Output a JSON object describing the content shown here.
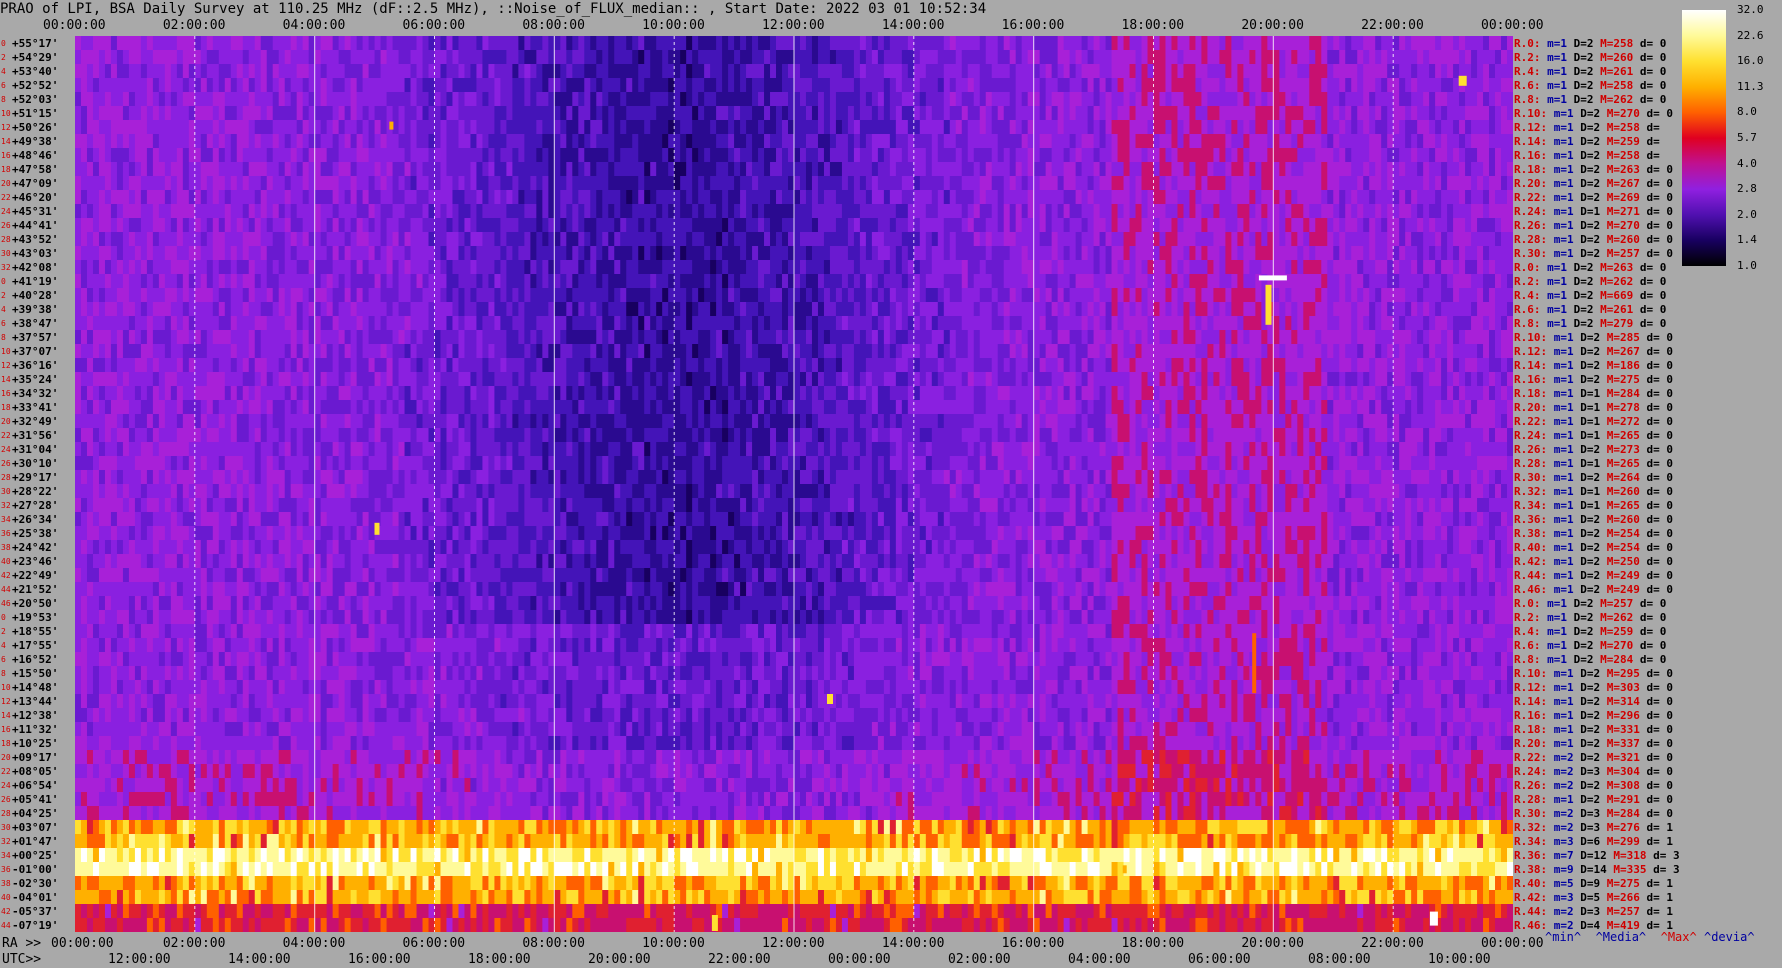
{
  "title": "PRAO of LPI, BSA Daily Survey at 110.25 MHz (dF::2.5 MHz), ::Noise_of_FLUX_median:: , Start Date: 2022 03 01 10:52:34",
  "chart_data": {
    "type": "heatmap",
    "top_axis_ticks": [
      "00:00:00",
      "02:00:00",
      "04:00:00",
      "06:00:00",
      "08:00:00",
      "10:00:00",
      "12:00:00",
      "14:00:00",
      "16:00:00",
      "18:00:00",
      "20:00:00",
      "22:00:00",
      "00:00:00"
    ],
    "ra_axis_prefix": "RA >>",
    "ra_axis_ticks": [
      "00:00:00",
      "02:00:00",
      "04:00:00",
      "06:00:00",
      "08:00:00",
      "10:00:00",
      "12:00:00",
      "14:00:00",
      "16:00:00",
      "18:00:00",
      "20:00:00",
      "22:00:00",
      "00:00:00"
    ],
    "utc_axis_prefix": "UTC>>",
    "utc_axis_ticks": [
      "12:00:00",
      "14:00:00",
      "16:00:00",
      "18:00:00",
      "20:00:00",
      "22:00:00",
      "00:00:00",
      "02:00:00",
      "04:00:00",
      "06:00:00",
      "08:00:00",
      "10:00:00"
    ],
    "colorbar_ticks": [
      "32.0",
      "22.6",
      "16.0",
      "11.3",
      "8.0",
      "5.7",
      "4.0",
      "2.8",
      "2.0",
      "1.4",
      "1.0"
    ],
    "colorbar_colors": [
      "#ffffff",
      "#fffa9a",
      "#ffe030",
      "#ffb000",
      "#ff6000",
      "#e00020",
      "#c01090",
      "#9020e0",
      "#5010b0",
      "#180060",
      "#000000"
    ],
    "y_labels": [
      "+55°17'",
      "+54°29'",
      "+53°40'",
      "+52°52'",
      "+52°03'",
      "+51°15'",
      "+50°26'",
      "+49°38'",
      "+48°46'",
      "+47°58'",
      "+47°09'",
      "+46°20'",
      "+45°31'",
      "+44°41'",
      "+43°52'",
      "+43°03'",
      "+42°08'",
      "+41°19'",
      "+40°28'",
      "+39°38'",
      "+38°47'",
      "+37°57'",
      "+37°07'",
      "+36°16'",
      "+35°24'",
      "+34°32'",
      "+33°41'",
      "+32°49'",
      "+31°56'",
      "+31°04'",
      "+30°10'",
      "+29°17'",
      "+28°22'",
      "+27°28'",
      "+26°34'",
      "+25°38'",
      "+24°42'",
      "+23°46'",
      "+22°49'",
      "+21°52'",
      "+20°50'",
      "+19°53'",
      "+18°55'",
      "+17°55'",
      "+16°52'",
      "+15°50'",
      "+14°48'",
      "+13°44'",
      "+12°38'",
      "+11°32'",
      "+10°25'",
      "+09°17'",
      "+08°05'",
      "+06°54'",
      "+05°41'",
      "+04°25'",
      "+03°07'",
      "+01°47'",
      "+00°25'",
      "-01°00'",
      "-02°30'",
      "-04°01'",
      "-05°37'",
      "-07°19'"
    ],
    "y_indices": [
      "0",
      "2",
      "4",
      "6",
      "8",
      "10",
      "12",
      "14",
      "16",
      "18",
      "20",
      "22",
      "24",
      "26",
      "28",
      "30",
      "32",
      "0",
      "2",
      "4",
      "6",
      "8",
      "10",
      "12",
      "14",
      "16",
      "18",
      "20",
      "22",
      "24",
      "26",
      "28",
      "30",
      "32",
      "34",
      "36",
      "38",
      "40",
      "42",
      "44",
      "46",
      "0",
      "2",
      "4",
      "6",
      "8",
      "10",
      "12",
      "14",
      "16",
      "18",
      "20",
      "22",
      "24",
      "26",
      "28",
      "30",
      "32",
      "34",
      "36",
      "38",
      "40",
      "42",
      "44"
    ],
    "stats_rows": [
      {
        "r": "R.0:",
        "m": "m=1",
        "d": "D=2",
        "M": "M=258",
        "dv": "d= 0"
      },
      {
        "r": "R.2:",
        "m": "m=1",
        "d": "D=2",
        "M": "M=260",
        "dv": "d= 0"
      },
      {
        "r": "R.4:",
        "m": "m=1",
        "d": "D=2",
        "M": "M=261",
        "dv": "d= 0"
      },
      {
        "r": "R.6:",
        "m": "m=1",
        "d": "D=2",
        "M": "M=258",
        "dv": "d= 0"
      },
      {
        "r": "R.8:",
        "m": "m=1",
        "d": "D=2",
        "M": "M=262",
        "dv": "d= 0"
      },
      {
        "r": "R.10:",
        "m": "m=1",
        "d": "D=2",
        "M": "M=270",
        "dv": "d= 0"
      },
      {
        "r": "R.12:",
        "m": "m=1",
        "d": "D=2",
        "M": "M=258",
        "dv": "d="
      },
      {
        "r": "R.14:",
        "m": "m=1",
        "d": "D=2",
        "M": "M=259",
        "dv": "d="
      },
      {
        "r": "R.16:",
        "m": "m=1",
        "d": "D=2",
        "M": "M=258",
        "dv": "d="
      },
      {
        "r": "R.18:",
        "m": "m=1",
        "d": "D=2",
        "M": "M=263",
        "dv": "d= 0"
      },
      {
        "r": "R.20:",
        "m": "m=1",
        "d": "D=2",
        "M": "M=267",
        "dv": "d= 0"
      },
      {
        "r": "R.22:",
        "m": "m=1",
        "d": "D=2",
        "M": "M=269",
        "dv": "d= 0"
      },
      {
        "r": "R.24:",
        "m": "m=1",
        "d": "D=1",
        "M": "M=271",
        "dv": "d= 0"
      },
      {
        "r": "R.26:",
        "m": "m=1",
        "d": "D=2",
        "M": "M=270",
        "dv": "d= 0"
      },
      {
        "r": "R.28:",
        "m": "m=1",
        "d": "D=2",
        "M": "M=260",
        "dv": "d= 0"
      },
      {
        "r": "R.30:",
        "m": "m=1",
        "d": "D=2",
        "M": "M=257",
        "dv": "d= 0"
      },
      {
        "r": "R.0:",
        "m": "m=1",
        "d": "D=2",
        "M": "M=263",
        "dv": "d= 0"
      },
      {
        "r": "R.2:",
        "m": "m=1",
        "d": "D=2",
        "M": "M=262",
        "dv": "d= 0"
      },
      {
        "r": "R.4:",
        "m": "m=1",
        "d": "D=2",
        "M": "M=669",
        "dv": "d= 0"
      },
      {
        "r": "R.6:",
        "m": "m=1",
        "d": "D=2",
        "M": "M=261",
        "dv": "d= 0"
      },
      {
        "r": "R.8:",
        "m": "m=1",
        "d": "D=2",
        "M": "M=279",
        "dv": "d= 0"
      },
      {
        "r": "R.10:",
        "m": "m=1",
        "d": "D=2",
        "M": "M=285",
        "dv": "d= 0"
      },
      {
        "r": "R.12:",
        "m": "m=1",
        "d": "D=2",
        "M": "M=267",
        "dv": "d= 0"
      },
      {
        "r": "R.14:",
        "m": "m=1",
        "d": "D=2",
        "M": "M=186",
        "dv": "d= 0"
      },
      {
        "r": "R.16:",
        "m": "m=1",
        "d": "D=2",
        "M": "M=275",
        "dv": "d= 0"
      },
      {
        "r": "R.18:",
        "m": "m=1",
        "d": "D=1",
        "M": "M=284",
        "dv": "d= 0"
      },
      {
        "r": "R.20:",
        "m": "m=1",
        "d": "D=1",
        "M": "M=278",
        "dv": "d= 0"
      },
      {
        "r": "R.22:",
        "m": "m=1",
        "d": "D=1",
        "M": "M=272",
        "dv": "d= 0"
      },
      {
        "r": "R.24:",
        "m": "m=1",
        "d": "D=1",
        "M": "M=265",
        "dv": "d= 0"
      },
      {
        "r": "R.26:",
        "m": "m=1",
        "d": "D=2",
        "M": "M=273",
        "dv": "d= 0"
      },
      {
        "r": "R.28:",
        "m": "m=1",
        "d": "D=1",
        "M": "M=265",
        "dv": "d= 0"
      },
      {
        "r": "R.30:",
        "m": "m=1",
        "d": "D=2",
        "M": "M=264",
        "dv": "d= 0"
      },
      {
        "r": "R.32:",
        "m": "m=1",
        "d": "D=1",
        "M": "M=260",
        "dv": "d= 0"
      },
      {
        "r": "R.34:",
        "m": "m=1",
        "d": "D=1",
        "M": "M=265",
        "dv": "d= 0"
      },
      {
        "r": "R.36:",
        "m": "m=1",
        "d": "D=2",
        "M": "M=260",
        "dv": "d= 0"
      },
      {
        "r": "R.38:",
        "m": "m=1",
        "d": "D=2",
        "M": "M=254",
        "dv": "d= 0"
      },
      {
        "r": "R.40:",
        "m": "m=1",
        "d": "D=2",
        "M": "M=254",
        "dv": "d= 0"
      },
      {
        "r": "R.42:",
        "m": "m=1",
        "d": "D=2",
        "M": "M=250",
        "dv": "d= 0"
      },
      {
        "r": "R.44:",
        "m": "m=1",
        "d": "D=2",
        "M": "M=249",
        "dv": "d= 0"
      },
      {
        "r": "R.46:",
        "m": "m=1",
        "d": "D=2",
        "M": "M=249",
        "dv": "d= 0"
      },
      {
        "r": "R.0:",
        "m": "m=1",
        "d": "D=2",
        "M": "M=257",
        "dv": "d= 0"
      },
      {
        "r": "R.2:",
        "m": "m=1",
        "d": "D=2",
        "M": "M=262",
        "dv": "d= 0"
      },
      {
        "r": "R.4:",
        "m": "m=1",
        "d": "D=2",
        "M": "M=259",
        "dv": "d= 0"
      },
      {
        "r": "R.6:",
        "m": "m=1",
        "d": "D=2",
        "M": "M=270",
        "dv": "d= 0"
      },
      {
        "r": "R.8:",
        "m": "m=1",
        "d": "D=2",
        "M": "M=284",
        "dv": "d= 0"
      },
      {
        "r": "R.10:",
        "m": "m=1",
        "d": "D=2",
        "M": "M=295",
        "dv": "d= 0"
      },
      {
        "r": "R.12:",
        "m": "m=1",
        "d": "D=2",
        "M": "M=303",
        "dv": "d= 0"
      },
      {
        "r": "R.14:",
        "m": "m=1",
        "d": "D=2",
        "M": "M=314",
        "dv": "d= 0"
      },
      {
        "r": "R.16:",
        "m": "m=1",
        "d": "D=2",
        "M": "M=296",
        "dv": "d= 0"
      },
      {
        "r": "R.18:",
        "m": "m=1",
        "d": "D=2",
        "M": "M=331",
        "dv": "d= 0"
      },
      {
        "r": "R.20:",
        "m": "m=1",
        "d": "D=2",
        "M": "M=337",
        "dv": "d= 0"
      },
      {
        "r": "R.22:",
        "m": "m=2",
        "d": "D=2",
        "M": "M=321",
        "dv": "d= 0"
      },
      {
        "r": "R.24:",
        "m": "m=2",
        "d": "D=3",
        "M": "M=304",
        "dv": "d= 0"
      },
      {
        "r": "R.26:",
        "m": "m=2",
        "d": "D=2",
        "M": "M=308",
        "dv": "d= 0"
      },
      {
        "r": "R.28:",
        "m": "m=1",
        "d": "D=2",
        "M": "M=291",
        "dv": "d= 0"
      },
      {
        "r": "R.30:",
        "m": "m=2",
        "d": "D=3",
        "M": "M=284",
        "dv": "d= 0"
      },
      {
        "r": "R.32:",
        "m": "m=2",
        "d": "D=3",
        "M": "M=276",
        "dv": "d= 1"
      },
      {
        "r": "R.34:",
        "m": "m=3",
        "d": "D=6",
        "M": "M=299",
        "dv": "d= 1"
      },
      {
        "r": "R.36:",
        "m": "m=7",
        "d": "D=12",
        "M": "M=318",
        "dv": "d= 3"
      },
      {
        "r": "R.38:",
        "m": "m=9",
        "d": "D=14",
        "M": "M=335",
        "dv": "d= 3"
      },
      {
        "r": "R.40:",
        "m": "m=5",
        "d": "D=9",
        "M": "M=275",
        "dv": "d= 1"
      },
      {
        "r": "R.42:",
        "m": "m=3",
        "d": "D=5",
        "M": "M=266",
        "dv": "d= 1"
      },
      {
        "r": "R.44:",
        "m": "m=2",
        "d": "D=3",
        "M": "M=257",
        "dv": "d= 1"
      },
      {
        "r": "R.46:",
        "m": "m=2",
        "d": "D=4",
        "M": "M=419",
        "dv": "d= 1"
      }
    ],
    "legend": {
      "min": "^min^",
      "med": "^Media^",
      "max": "^Max^",
      "dev": "^devia^"
    }
  }
}
